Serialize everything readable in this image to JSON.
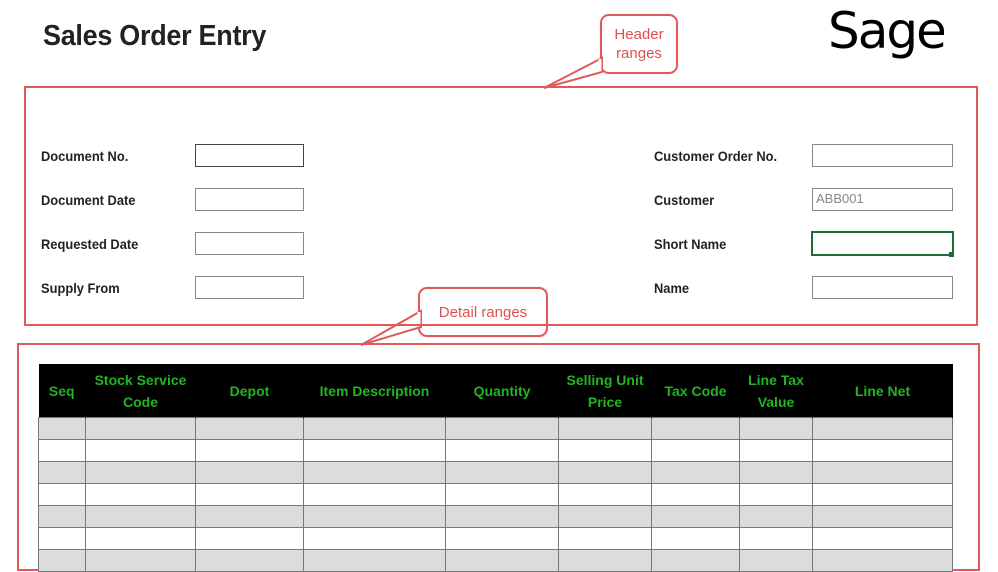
{
  "page": {
    "title": "Sales Order Entry"
  },
  "brand": {
    "logo_text": "Sage",
    "accent": "#23b323",
    "annotation_color": "#e05a5a"
  },
  "callouts": {
    "header_line1": "Header",
    "header_line2": "ranges",
    "detail": "Detail ranges"
  },
  "header_fields": {
    "document_no": {
      "label": "Document No.",
      "value": ""
    },
    "document_date": {
      "label": "Document Date",
      "value": ""
    },
    "requested_date": {
      "label": "Requested Date",
      "value": ""
    },
    "supply_from": {
      "label": "Supply From",
      "value": ""
    },
    "customer_order_no": {
      "label": "Customer Order No.",
      "value": ""
    },
    "customer": {
      "label": "Customer",
      "value": "ABB001"
    },
    "short_name": {
      "label": "Short Name",
      "value": ""
    },
    "name": {
      "label": "Name",
      "value": ""
    }
  },
  "detail_table": {
    "columns": [
      {
        "line1": "Seq",
        "line2": ""
      },
      {
        "line1": "Stock  Service",
        "line2": "Code"
      },
      {
        "line1": "Depot",
        "line2": ""
      },
      {
        "line1": "Item Description",
        "line2": ""
      },
      {
        "line1": "Quantity",
        "line2": ""
      },
      {
        "line1": "Selling Unit",
        "line2": "Price"
      },
      {
        "line1": "Tax Code",
        "line2": ""
      },
      {
        "line1": "Line Tax",
        "line2": "Value"
      },
      {
        "line1": "Line Net",
        "line2": ""
      }
    ],
    "rows": [
      [
        "",
        "",
        "",
        "",
        "",
        "",
        "",
        "",
        ""
      ],
      [
        "",
        "",
        "",
        "",
        "",
        "",
        "",
        "",
        ""
      ],
      [
        "",
        "",
        "",
        "",
        "",
        "",
        "",
        "",
        ""
      ],
      [
        "",
        "",
        "",
        "",
        "",
        "",
        "",
        "",
        ""
      ],
      [
        "",
        "",
        "",
        "",
        "",
        "",
        "",
        "",
        ""
      ],
      [
        "",
        "",
        "",
        "",
        "",
        "",
        "",
        "",
        ""
      ],
      [
        "",
        "",
        "",
        "",
        "",
        "",
        "",
        "",
        ""
      ]
    ]
  }
}
